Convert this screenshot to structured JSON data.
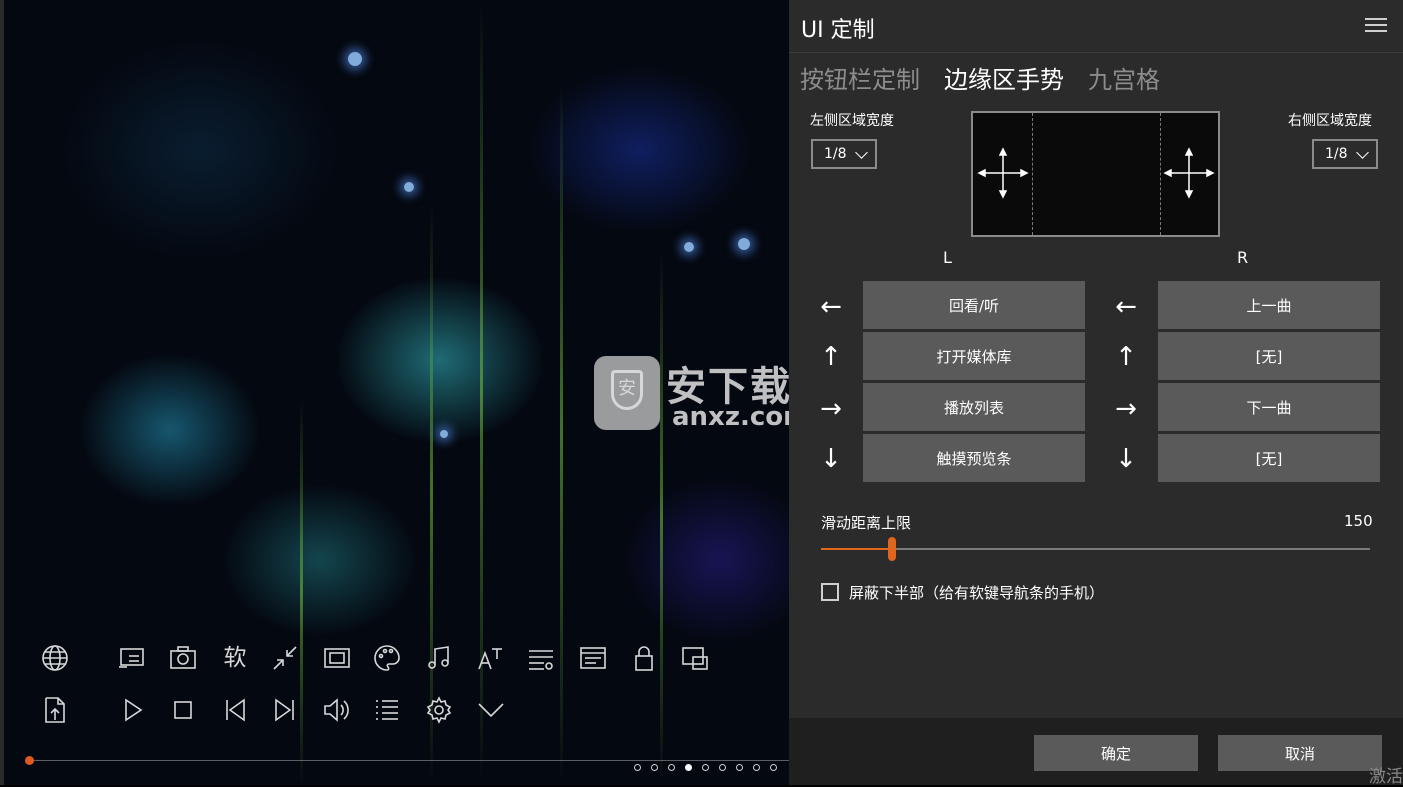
{
  "panel": {
    "title": "UI 定制",
    "tabs": [
      {
        "label": "按钮栏定制",
        "active": false
      },
      {
        "label": "边缘区手势",
        "active": true
      },
      {
        "label": "九宫格",
        "active": false
      }
    ],
    "left_width": {
      "label": "左侧区域宽度",
      "value": "1/8"
    },
    "right_width": {
      "label": "右侧区域宽度",
      "value": "1/8"
    },
    "col_left_label": "L",
    "col_right_label": "R",
    "left_actions": [
      {
        "arrow": "←",
        "label": "回看/听"
      },
      {
        "arrow": "↑",
        "label": "打开媒体库"
      },
      {
        "arrow": "→",
        "label": "播放列表"
      },
      {
        "arrow": "↓",
        "label": "触摸预览条"
      }
    ],
    "right_actions": [
      {
        "arrow": "←",
        "label": "上一曲"
      },
      {
        "arrow": "↑",
        "label": "[无]"
      },
      {
        "arrow": "→",
        "label": "下一曲"
      },
      {
        "arrow": "↓",
        "label": "[无]"
      }
    ],
    "slider": {
      "label": "滑动距离上限",
      "value": "150",
      "fraction": 0.13
    },
    "checkbox": {
      "label": "屏蔽下半部（给有软键导航条的手机）",
      "checked": false
    },
    "ok_button": "确定",
    "cancel_button": "取消",
    "corner_text": "激活"
  },
  "player": {
    "soft_label": "软",
    "progress_fraction": 0.0,
    "page_dots_count": 9,
    "page_dots_active": 3
  },
  "watermark": {
    "cn": "安下载",
    "en": "anxz.com",
    "logo_char": "安"
  },
  "colors": {
    "accent": "#e0651d",
    "panel_bg": "#2b2b2b",
    "button_bg": "#5a5a5a"
  }
}
